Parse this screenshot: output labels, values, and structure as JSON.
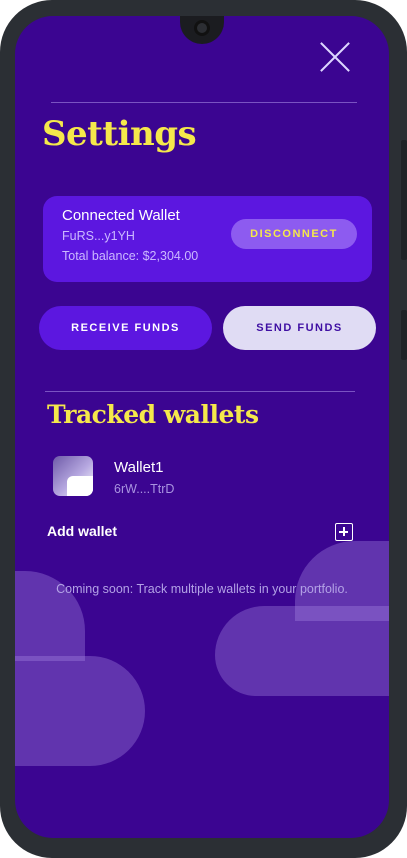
{
  "settings": {
    "title": "Settings",
    "connected_wallet": {
      "label": "Connected Wallet",
      "address": "FuRS...y1YH",
      "balance": "Total balance: $2,304.00",
      "disconnect_label": "DISCONNECT"
    },
    "actions": {
      "receive_label": "RECEIVE FUNDS",
      "send_label": "SEND FUNDS"
    }
  },
  "tracked": {
    "title": "Tracked wallets",
    "wallets": [
      {
        "name": "Wallet1",
        "address": "6rW....TtrD"
      }
    ],
    "add_label": "Add wallet",
    "coming_soon": "Coming soon: Track multiple wallets in your portfolio."
  },
  "icons": {
    "close": "close-icon",
    "add": "add-icon",
    "wallet": "wallet-avatar-icon"
  },
  "colors": {
    "background": "#3b0591",
    "card": "#5c17e0",
    "accent_yellow": "#f5e84b",
    "send_button": "#e0dcf4"
  }
}
